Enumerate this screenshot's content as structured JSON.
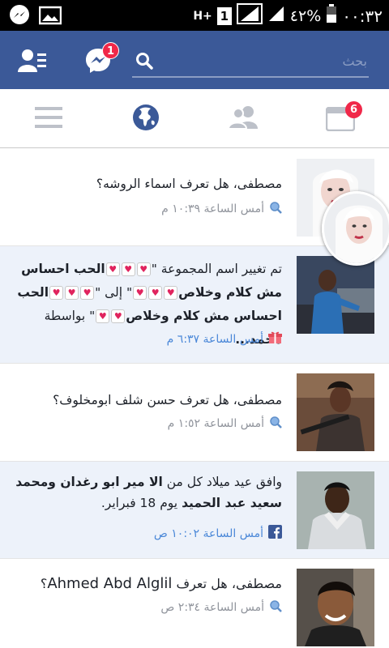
{
  "status_bar": {
    "network": "H+",
    "sim_slot": "1",
    "battery_percent": "٤٢%",
    "time": "٠٠:٣٢",
    "icons": [
      "messenger-icon",
      "gallery-icon",
      "signal-icon",
      "battery-icon"
    ]
  },
  "app_bar": {
    "search_placeholder": "بحث",
    "messenger_badge": "1",
    "icons": [
      "search-icon",
      "messenger-icon",
      "friend-requests-icon"
    ],
    "color": "#3b5998"
  },
  "tabs": {
    "notifications_badge": "6",
    "items": [
      "news-feed-tab",
      "friend-requests-tab",
      "notifications-tab",
      "menu-tab"
    ],
    "active_color": "#3b5998",
    "inactive_color": "#bdc1c9"
  },
  "notifications": [
    {
      "text": "مصطفى، هل تعرف اسماء الروشه؟",
      "time": "أمس الساعة ١٠:٣٩ م",
      "icon": "search-icon",
      "unread": false
    },
    {
      "text_parts": {
        "prefix": "تم تغيير اسم المجموعة \"",
        "line1_name": "الحب  احساس",
        "line2_name": "مش كلام وخلاص",
        "to_word": "\" إلى \"",
        "line3_name": "الحب",
        "line4_name": "احساس مش كلام وخلاص",
        "by_word": "\" بواسطة",
        "author": "محمد..."
      },
      "time": "أمس الساعة ٦:٣٧ م",
      "icon": "gift-icon",
      "unread": true
    },
    {
      "text": "مصطفى، هل تعرف حسن شلف ابومخلوف؟",
      "time": "أمس الساعة ١:٥٢ م",
      "icon": "search-icon",
      "unread": false
    },
    {
      "text_parts": {
        "prefix": "وافق عيد ميلاد كل من",
        "name1": "الا مير ابو رغدان ومحمد",
        "name2": "سعيد عبد الحميد",
        "suffix": "يوم 18 فبراير."
      },
      "time": "أمس الساعة ١٠:٠٢ ص",
      "icon": "facebook-icon",
      "unread": true
    },
    {
      "text_parts": {
        "prefix": "مصطفى، هل تعرف",
        "name": "Ahmed Abd Alglil",
        "suffix": "؟"
      },
      "time": "أمس الساعة ٢:٣٤ ص",
      "icon": "search-icon",
      "unread": false
    }
  ],
  "colors": {
    "unread_bg": "#edf2fa",
    "badge": "#f02849",
    "time_grey": "#90949c",
    "time_blue": "#4b88d8"
  }
}
